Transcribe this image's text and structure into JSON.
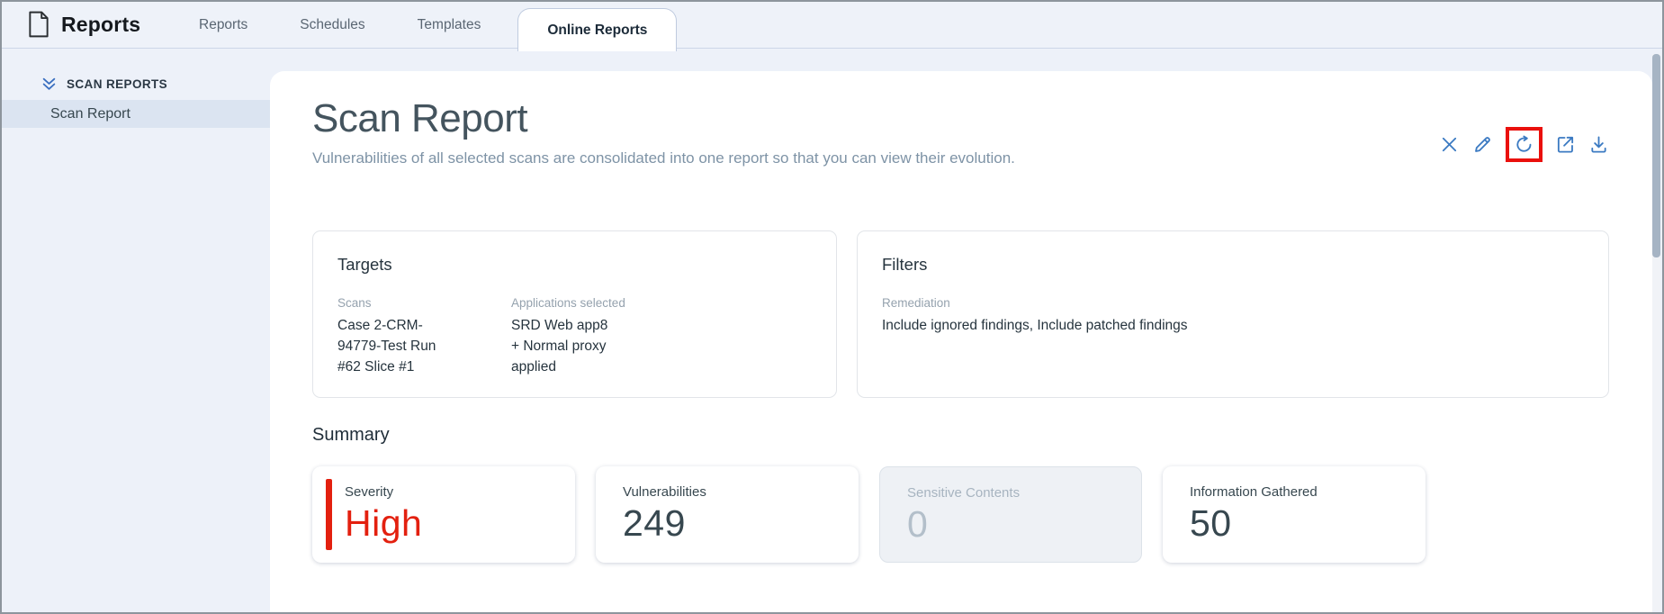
{
  "app": {
    "title": "Reports"
  },
  "tabs": [
    {
      "label": "Reports",
      "active": false
    },
    {
      "label": "Schedules",
      "active": false
    },
    {
      "label": "Templates",
      "active": false
    },
    {
      "label": "Online Reports",
      "active": true
    }
  ],
  "sidebar": {
    "section_label": "SCAN REPORTS",
    "items": [
      {
        "label": "Scan Report",
        "selected": true
      }
    ]
  },
  "report": {
    "title": "Scan Report",
    "subtitle": "Vulnerabilities of all selected scans are consolidated into one report so that you can view their evolution.",
    "actions": [
      {
        "icon": "close-icon"
      },
      {
        "icon": "edit-icon"
      },
      {
        "icon": "refresh-icon",
        "highlighted": true
      },
      {
        "icon": "open-in-new-icon"
      },
      {
        "icon": "download-icon"
      }
    ]
  },
  "cards": {
    "targets": {
      "title": "Targets",
      "fields": [
        {
          "label": "Scans",
          "value": "Case 2-CRM-\n94779-Test Run\n#62 Slice #1"
        },
        {
          "label": "Applications selected",
          "value": "SRD Web app8\n+ Normal proxy\napplied"
        }
      ]
    },
    "filters": {
      "title": "Filters",
      "fields": [
        {
          "label": "Remediation",
          "value": "Include ignored findings, Include patched findings"
        }
      ]
    }
  },
  "summary": {
    "heading": "Summary",
    "stats": [
      {
        "label": "Severity",
        "value": "High",
        "state": "enabled",
        "accent": true
      },
      {
        "label": "Vulnerabilities",
        "value": "249",
        "state": "enabled",
        "accent": false
      },
      {
        "label": "Sensitive Contents",
        "value": "0",
        "state": "disabled",
        "accent": false
      },
      {
        "label": "Information Gathered",
        "value": "50",
        "state": "enabled",
        "accent": false
      }
    ]
  },
  "colors": {
    "icon_blue": "#3b7ac2",
    "severity_red": "#e3200f",
    "annotation_red": "#ea100c",
    "selected_item_bg": "#dbe4f1",
    "page_bg": "#edf1f9"
  }
}
